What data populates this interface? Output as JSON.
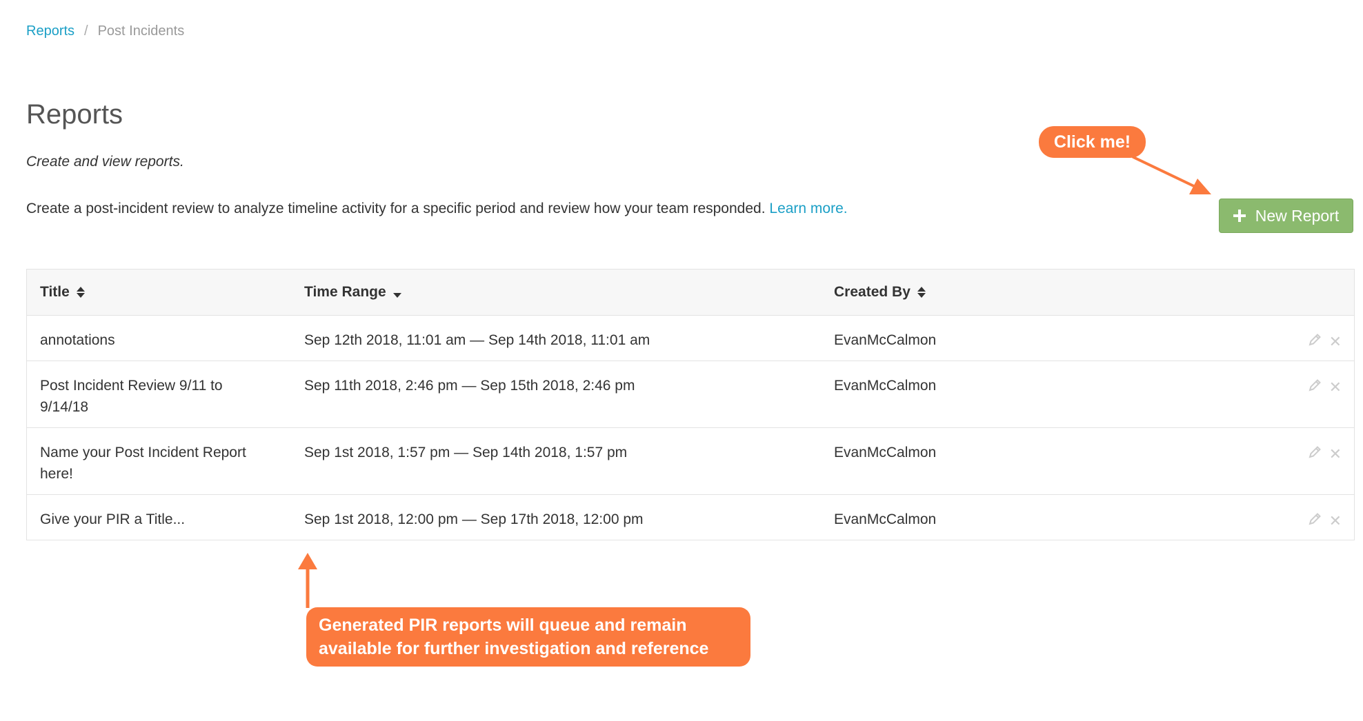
{
  "breadcrumb": {
    "root": "Reports",
    "separator": "/",
    "current": "Post Incidents"
  },
  "header": {
    "title": "Reports",
    "subtitle": "Create and view reports.",
    "description": "Create a post-incident review to analyze timeline activity for a specific period and review how your team responded.",
    "learn_more": "Learn more."
  },
  "toolbar": {
    "new_report_label": "New Report",
    "new_report_icon": "plus-icon"
  },
  "table": {
    "columns": [
      {
        "label": "Title",
        "sort": "sort-both"
      },
      {
        "label": "Time Range",
        "sort": "sort-desc"
      },
      {
        "label": "Created By",
        "sort": "sort-both"
      }
    ],
    "rows": [
      {
        "title": "annotations",
        "time_range": "Sep 12th 2018, 11:01 am — Sep 14th 2018, 11:01 am",
        "created_by": "EvanMcCalmon"
      },
      {
        "title": "Post Incident Review 9/11 to 9/14/18",
        "time_range": "Sep 11th 2018, 2:46 pm — Sep 15th 2018, 2:46 pm",
        "created_by": "EvanMcCalmon"
      },
      {
        "title": "Name your Post Incident Report here!",
        "time_range": "Sep 1st 2018, 1:57 pm — Sep 14th 2018, 1:57 pm",
        "created_by": "EvanMcCalmon"
      },
      {
        "title": "Give your PIR a Title...",
        "time_range": "Sep 1st 2018, 12:00 pm — Sep 17th 2018, 12:00 pm",
        "created_by": "EvanMcCalmon"
      }
    ],
    "row_actions": {
      "edit_icon": "pencil-icon",
      "delete_icon": "close-icon",
      "delete_glyph": "✕"
    }
  },
  "annotations": {
    "click_me": "Click me!",
    "pir_note": "Generated PIR reports will queue and remain available for further investigation and reference"
  },
  "colors": {
    "link": "#1b9fc6",
    "button_green": "#8bba6e",
    "callout_orange": "#fb7a3e",
    "border": "#e3e3e3",
    "header_bg": "#f7f7f7"
  }
}
